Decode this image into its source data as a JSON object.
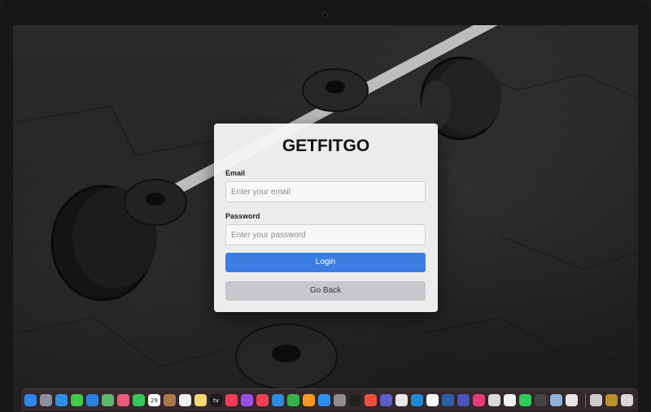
{
  "login": {
    "title": "GETFITGO",
    "email_label": "Email",
    "email_placeholder": "Enter your email",
    "password_label": "Password",
    "password_placeholder": "Enter your password",
    "login_button": "Login",
    "back_button": "Go Back"
  },
  "calendar_day": "29",
  "tv_label": "tv",
  "colors": {
    "primary_button": "#3b7de0",
    "secondary_button": "#c7c8cc",
    "card_background": "#f5f5f6"
  },
  "dock": {
    "apps": [
      {
        "name": "finder-icon",
        "color": "#2d86e8"
      },
      {
        "name": "launchpad-icon",
        "color": "#8b8fa0"
      },
      {
        "name": "safari-icon",
        "color": "#2f8fe6"
      },
      {
        "name": "messages-icon",
        "color": "#3ec94c"
      },
      {
        "name": "mail-icon",
        "color": "#2f7fe0"
      },
      {
        "name": "maps-icon",
        "color": "#5fb86a"
      },
      {
        "name": "photos-icon",
        "color": "#e85d7a"
      },
      {
        "name": "facetime-icon",
        "color": "#34c759"
      },
      {
        "name": "calendar-icon",
        "color": "#ffffff"
      },
      {
        "name": "notes-folder-icon",
        "color": "#a87b4a"
      },
      {
        "name": "reminders-icon",
        "color": "#f2f2f2"
      },
      {
        "name": "notes-icon",
        "color": "#f7d774"
      },
      {
        "name": "apple-tv-icon",
        "color": "#1c1c1e"
      },
      {
        "name": "music-icon",
        "color": "#fa3c5a"
      },
      {
        "name": "podcasts-icon",
        "color": "#9b4fe0"
      },
      {
        "name": "news-icon",
        "color": "#f0414e"
      },
      {
        "name": "keynote-icon",
        "color": "#2f8ae0"
      },
      {
        "name": "numbers-icon",
        "color": "#35b34a"
      },
      {
        "name": "pages-icon",
        "color": "#f59a23"
      },
      {
        "name": "app-store-icon",
        "color": "#2f8ff0"
      },
      {
        "name": "system-settings-icon",
        "color": "#8e8e93"
      },
      {
        "name": "terminal-icon",
        "color": "#222222"
      },
      {
        "name": "swift-icon",
        "color": "#f05138"
      },
      {
        "name": "teams-icon",
        "color": "#5b5fc7"
      },
      {
        "name": "chrome-icon",
        "color": "#e8e8e8"
      },
      {
        "name": "vscode-icon",
        "color": "#1e88d6"
      },
      {
        "name": "mongodb-icon",
        "color": "#ffffff"
      },
      {
        "name": "wireshark-icon",
        "color": "#2b5fa8"
      },
      {
        "name": "teams-alt-icon",
        "color": "#4b53bc"
      },
      {
        "name": "intellij-icon",
        "color": "#e8397a"
      },
      {
        "name": "installer-icon",
        "color": "#d9d9d9"
      },
      {
        "name": "postman-icon",
        "color": "#f2f2f2"
      },
      {
        "name": "whatsapp-icon",
        "color": "#2fcc5b"
      },
      {
        "name": "xcode-instruments-icon",
        "color": "#444444"
      },
      {
        "name": "preview-icon",
        "color": "#8fb0d8"
      },
      {
        "name": "archive-utility-icon",
        "color": "#e6e6e6"
      }
    ],
    "trailing": [
      {
        "name": "document-stack-icon",
        "color": "#cfcfcf"
      },
      {
        "name": "preview-stack-icon",
        "color": "#b8902c"
      },
      {
        "name": "trash-icon",
        "color": "#d8d8d8"
      }
    ]
  }
}
